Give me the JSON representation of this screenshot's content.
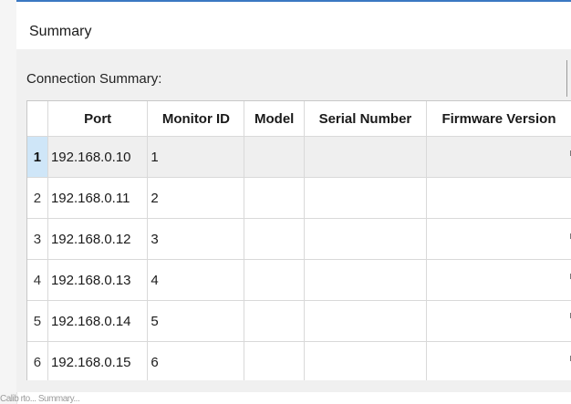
{
  "summary": {
    "title": "Summary",
    "connection_label": "Connection Summary:"
  },
  "table": {
    "columns": [
      "",
      "Port",
      "Monitor ID",
      "Model",
      "Serial Number",
      "Firmware Version"
    ],
    "rows": [
      {
        "num": "1",
        "port": "192.168.0.10",
        "monitor_id": "1",
        "model": "",
        "serial": "",
        "firmware": "",
        "selected": true
      },
      {
        "num": "2",
        "port": "192.168.0.11",
        "monitor_id": "2",
        "model": "",
        "serial": "",
        "firmware": "",
        "selected": false
      },
      {
        "num": "3",
        "port": "192.168.0.12",
        "monitor_id": "3",
        "model": "",
        "serial": "",
        "firmware": "",
        "selected": false
      },
      {
        "num": "4",
        "port": "192.168.0.13",
        "monitor_id": "4",
        "model": "",
        "serial": "",
        "firmware": "",
        "selected": false
      },
      {
        "num": "5",
        "port": "192.168.0.14",
        "monitor_id": "5",
        "model": "",
        "serial": "",
        "firmware": "",
        "selected": false
      },
      {
        "num": "6",
        "port": "192.168.0.15",
        "monitor_id": "6",
        "model": "",
        "serial": "",
        "firmware": "",
        "selected": false
      }
    ]
  },
  "footer": {
    "garbled_text": "Calib rto... Summary..."
  },
  "colors": {
    "accent": "#3a78c2",
    "selected_row_header": "#cfe6f8",
    "selected_row": "#efefef"
  }
}
